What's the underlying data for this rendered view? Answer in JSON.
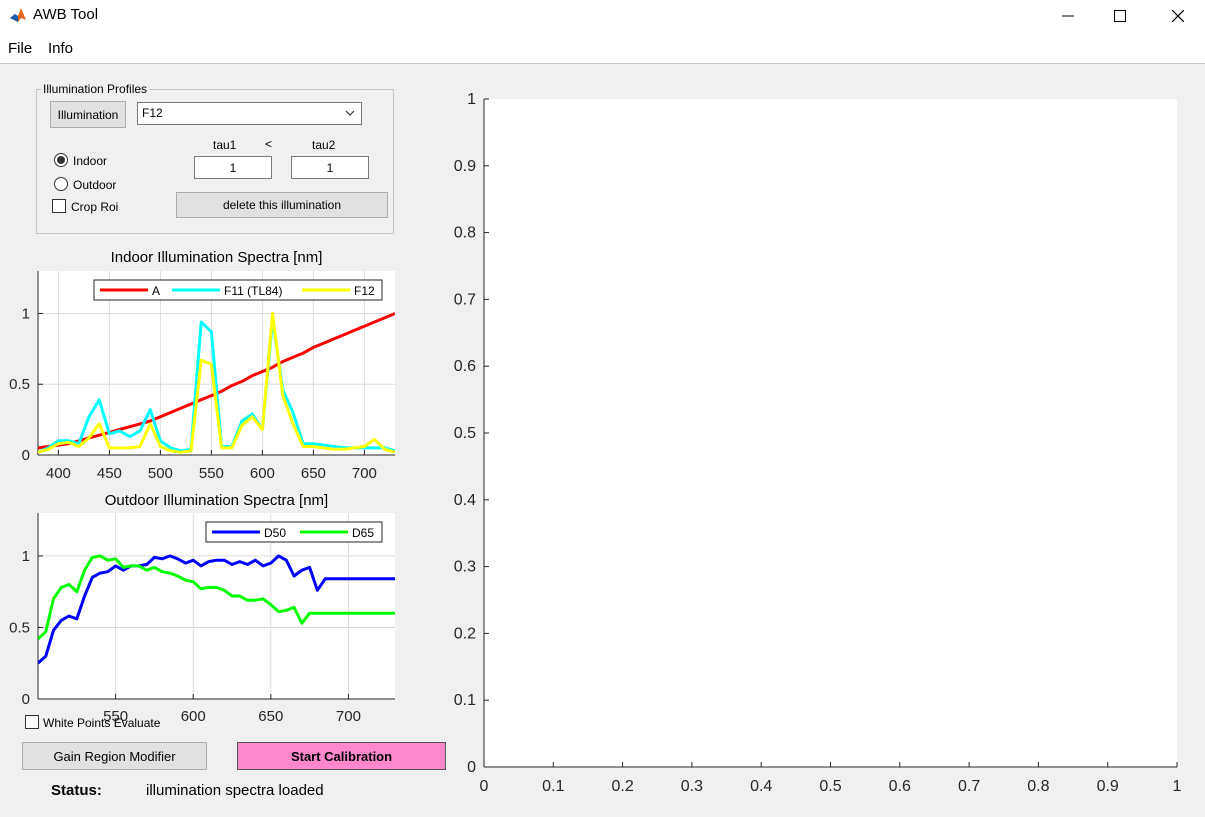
{
  "window": {
    "title": "AWB Tool"
  },
  "menu": [
    "File",
    "Info"
  ],
  "profiles": {
    "title": "Illumination Profiles",
    "illumination_button": "Illumination",
    "selected": "F12",
    "tau1_label": "tau1",
    "lt": "<",
    "tau2_label": "tau2",
    "tau1": "1",
    "tau2": "1",
    "indoor": "Indoor",
    "outdoor": "Outdoor",
    "crop_roi": "Crop Roi",
    "delete_button": "delete this illumination",
    "mode": "Indoor",
    "crop_roi_checked": false
  },
  "white_points_evaluate": {
    "label": "White Points Evaluate",
    "checked": false
  },
  "buttons": {
    "gain_region": "Gain Region Modifier",
    "start_calibration": "Start Calibration"
  },
  "status": {
    "label": "Status:",
    "text": "illumination spectra loaded"
  },
  "colors": {
    "A": "#ff0000",
    "F11": "#00ffff",
    "F12": "#ffff00",
    "D50": "#0000ff",
    "D65": "#00ff00",
    "start_button": "#ff88cc"
  },
  "chart_data": [
    {
      "type": "line",
      "title": "Indoor Illumination Spectra [nm]",
      "xlim": [
        380,
        730
      ],
      "ylim": [
        0,
        1.3
      ],
      "xticks": [
        400,
        450,
        500,
        550,
        600,
        650,
        700
      ],
      "yticks": [
        0,
        0.5,
        1
      ],
      "grid": true,
      "legend": "top-right",
      "x": [
        380,
        390,
        400,
        410,
        420,
        430,
        440,
        450,
        460,
        470,
        480,
        490,
        500,
        510,
        520,
        530,
        540,
        550,
        560,
        570,
        580,
        590,
        600,
        610,
        620,
        630,
        640,
        650,
        660,
        670,
        680,
        690,
        700,
        710,
        720,
        730
      ],
      "series": [
        {
          "name": "A",
          "values": [
            0.05,
            0.06,
            0.07,
            0.08,
            0.1,
            0.12,
            0.14,
            0.16,
            0.18,
            0.2,
            0.22,
            0.24,
            0.27,
            0.3,
            0.33,
            0.36,
            0.39,
            0.42,
            0.45,
            0.49,
            0.52,
            0.56,
            0.59,
            0.62,
            0.66,
            0.69,
            0.72,
            0.76,
            0.79,
            0.82,
            0.85,
            0.88,
            0.91,
            0.94,
            0.97,
            1.0
          ]
        },
        {
          "name": "F11 (TL84)",
          "values": [
            0.02,
            0.05,
            0.1,
            0.1,
            0.08,
            0.27,
            0.39,
            0.15,
            0.17,
            0.13,
            0.17,
            0.32,
            0.1,
            0.05,
            0.03,
            0.04,
            0.94,
            0.87,
            0.06,
            0.06,
            0.24,
            0.29,
            0.18,
            0.96,
            0.46,
            0.3,
            0.08,
            0.08,
            0.07,
            0.06,
            0.05,
            0.05,
            0.05,
            0.05,
            0.05,
            0.03
          ]
        },
        {
          "name": "F12",
          "values": [
            0.02,
            0.04,
            0.08,
            0.09,
            0.06,
            0.12,
            0.22,
            0.05,
            0.05,
            0.05,
            0.06,
            0.22,
            0.06,
            0.03,
            0.02,
            0.03,
            0.67,
            0.64,
            0.05,
            0.05,
            0.21,
            0.27,
            0.18,
            1.0,
            0.42,
            0.22,
            0.06,
            0.06,
            0.05,
            0.04,
            0.04,
            0.05,
            0.06,
            0.11,
            0.04,
            0.02
          ]
        }
      ]
    },
    {
      "type": "line",
      "title": "Outdoor Illumination Spectra [nm]",
      "xlim": [
        500,
        730
      ],
      "ylim": [
        0,
        1.3
      ],
      "xticks": [
        550,
        600,
        650,
        700
      ],
      "yticks": [
        0,
        0.5,
        1
      ],
      "grid": true,
      "legend": "top-right",
      "x": [
        500,
        505,
        510,
        515,
        520,
        525,
        530,
        535,
        540,
        545,
        550,
        555,
        560,
        565,
        570,
        575,
        580,
        585,
        590,
        595,
        600,
        605,
        610,
        615,
        620,
        625,
        630,
        635,
        640,
        645,
        650,
        655,
        660,
        665,
        670,
        675,
        680,
        685,
        690,
        695,
        700,
        705,
        710,
        715,
        720,
        725,
        730
      ],
      "series": [
        {
          "name": "D50",
          "values": [
            0.25,
            0.3,
            0.48,
            0.55,
            0.58,
            0.56,
            0.72,
            0.85,
            0.88,
            0.89,
            0.93,
            0.9,
            0.93,
            0.93,
            0.94,
            0.99,
            0.98,
            1.0,
            0.98,
            0.95,
            0.97,
            0.93,
            0.96,
            0.97,
            0.97,
            0.94,
            0.96,
            0.94,
            0.97,
            0.93,
            0.95,
            1.0,
            0.97,
            0.86,
            0.9,
            0.92,
            0.76,
            0.84,
            0.84,
            0.84,
            0.84,
            0.84,
            0.84,
            0.84,
            0.84,
            0.84,
            0.84
          ]
        },
        {
          "name": "D65",
          "values": [
            0.42,
            0.47,
            0.7,
            0.78,
            0.8,
            0.75,
            0.9,
            0.99,
            1.0,
            0.97,
            0.98,
            0.92,
            0.93,
            0.93,
            0.9,
            0.92,
            0.89,
            0.88,
            0.86,
            0.83,
            0.82,
            0.77,
            0.78,
            0.78,
            0.76,
            0.72,
            0.72,
            0.69,
            0.69,
            0.7,
            0.66,
            0.61,
            0.62,
            0.64,
            0.53,
            0.6,
            0.6,
            0.6,
            0.6,
            0.6,
            0.6,
            0.6,
            0.6,
            0.6,
            0.6,
            0.6,
            0.6
          ]
        }
      ]
    },
    {
      "type": "scatter",
      "title": "",
      "xlim": [
        0,
        1
      ],
      "ylim": [
        0,
        1
      ],
      "xticks": [
        0,
        0.1,
        0.2,
        0.3,
        0.4,
        0.5,
        0.6,
        0.7,
        0.8,
        0.9,
        1
      ],
      "yticks": [
        0,
        0.1,
        0.2,
        0.3,
        0.4,
        0.5,
        0.6,
        0.7,
        0.8,
        0.9,
        1
      ],
      "grid": false,
      "series": []
    }
  ]
}
